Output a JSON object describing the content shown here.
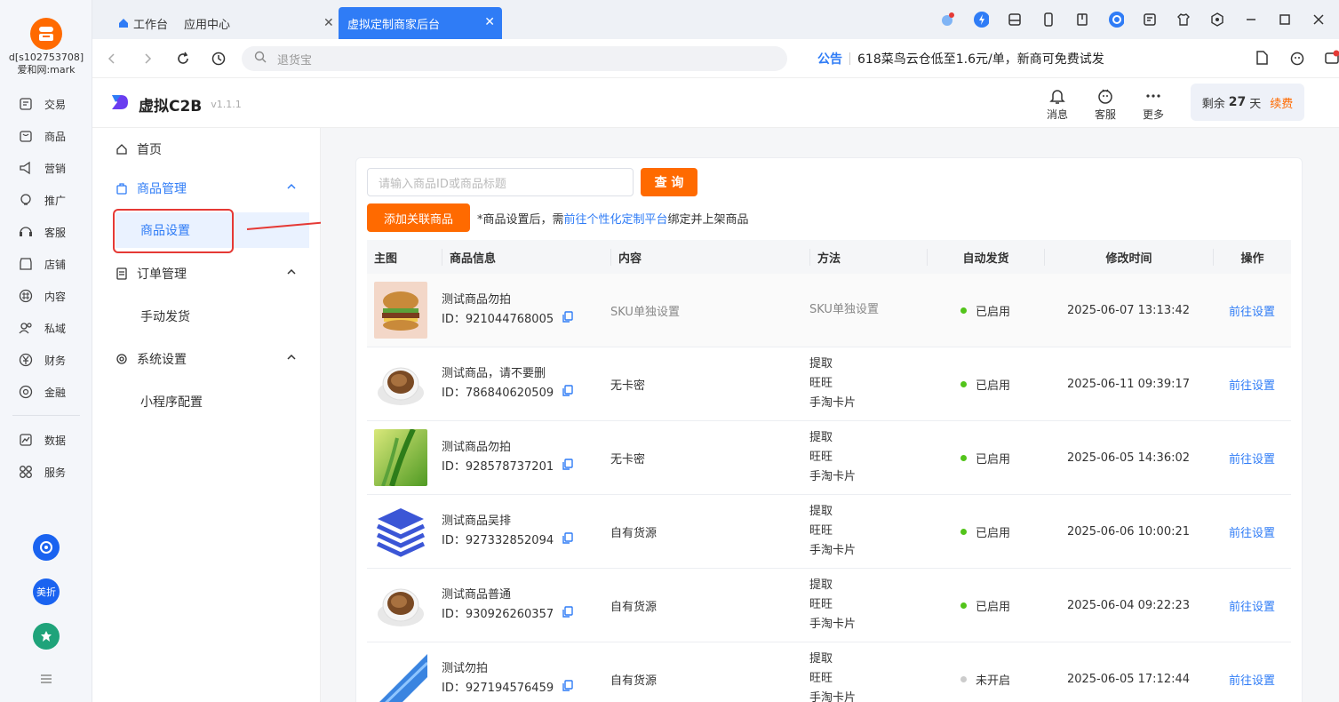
{
  "rail": {
    "user_line1": "d[s102753708]",
    "user_line2": "爱和网:mark",
    "items": [
      {
        "label": "交易",
        "icon": "trade-icon"
      },
      {
        "label": "商品",
        "icon": "goods-icon"
      },
      {
        "label": "营销",
        "icon": "marketing-icon"
      },
      {
        "label": "推广",
        "icon": "promotion-icon"
      },
      {
        "label": "客服",
        "icon": "service-icon"
      },
      {
        "label": "店铺",
        "icon": "shop-icon"
      },
      {
        "label": "内容",
        "icon": "content-icon"
      },
      {
        "label": "私域",
        "icon": "private-icon"
      },
      {
        "label": "财务",
        "icon": "finance-icon"
      },
      {
        "label": "金融",
        "icon": "banking-icon"
      }
    ],
    "items2": [
      {
        "label": "数据",
        "icon": "data-icon"
      },
      {
        "label": "服务",
        "icon": "services-icon"
      }
    ],
    "app_meizhe": "美折"
  },
  "tabs": {
    "workbench": "工作台",
    "app_center": "应用中心",
    "active": "虚拟定制商家后台"
  },
  "address": {
    "placeholder": "退货宝",
    "notice_tag": "公告",
    "notice_text": "618菜鸟云仓低至1.6元/单，新商可免费试发"
  },
  "plugin": {
    "name": "虚拟C2B",
    "version": "v1.1.1",
    "msg": "消息",
    "service": "客服",
    "more": "更多",
    "remain_prefix": "剩余",
    "remain_days": "27",
    "remain_unit": "天",
    "renew": "续费"
  },
  "menu": {
    "home": "首页",
    "goods_mgmt": "商品管理",
    "goods_settings": "商品设置",
    "order_mgmt": "订单管理",
    "manual_ship": "手动发货",
    "sys_settings": "系统设置",
    "mini_config": "小程序配置"
  },
  "search": {
    "placeholder": "请输入商品ID或商品标题",
    "query_btn": "查 询",
    "add_btn": "添加关联商品",
    "tip_prefix": "*商品设置后，需",
    "tip_link": "前往个性化定制平台",
    "tip_suffix": "绑定并上架商品"
  },
  "table": {
    "headers": [
      "主图",
      "商品信息",
      "内容",
      "方法",
      "自动发货",
      "修改时间",
      "操作"
    ],
    "id_prefix": "ID：",
    "rows": [
      {
        "name": "测试商品勿拍",
        "id": "921044768005",
        "content": "SKU单独设置",
        "methods": [
          "SKU单独设置"
        ],
        "status": "已启用",
        "enabled": true,
        "time": "2025-06-07 13:13:42",
        "action": "前往设置",
        "thumb": "burger"
      },
      {
        "name": "测试商品，请不要删",
        "id": "786840620509",
        "content": "无卡密",
        "methods": [
          "提取",
          "旺旺",
          "手淘卡片"
        ],
        "status": "已启用",
        "enabled": true,
        "time": "2025-06-11 09:39:17",
        "action": "前往设置",
        "thumb": "coffee"
      },
      {
        "name": "测试商品勿拍",
        "id": "928578737201",
        "content": "无卡密",
        "methods": [
          "提取",
          "旺旺",
          "手淘卡片"
        ],
        "status": "已启用",
        "enabled": true,
        "time": "2025-06-05 14:36:02",
        "action": "前往设置",
        "thumb": "leaf"
      },
      {
        "name": "测试商品吴排",
        "id": "927332852094",
        "content": "自有货源",
        "methods": [
          "提取",
          "旺旺",
          "手淘卡片"
        ],
        "status": "已启用",
        "enabled": true,
        "time": "2025-06-06 10:00:21",
        "action": "前往设置",
        "thumb": "stack"
      },
      {
        "name": "测试商品普通",
        "id": "930926260357",
        "content": "自有货源",
        "methods": [
          "提取",
          "旺旺",
          "手淘卡片"
        ],
        "status": "已启用",
        "enabled": true,
        "time": "2025-06-04 09:22:23",
        "action": "前往设置",
        "thumb": "coffee"
      },
      {
        "name": "测试勿拍",
        "id": "927194576459",
        "content": "自有货源",
        "methods": [
          "提取",
          "旺旺",
          "手淘卡片"
        ],
        "status": "未开启",
        "enabled": false,
        "time": "2025-06-05 17:12:44",
        "action": "前往设置",
        "thumb": "blue"
      }
    ]
  },
  "colors": {
    "accent": "#ff6a00",
    "primary": "#2f7cf6",
    "enabled_dot": "#52c41a",
    "disabled_dot": "#cccccc"
  }
}
